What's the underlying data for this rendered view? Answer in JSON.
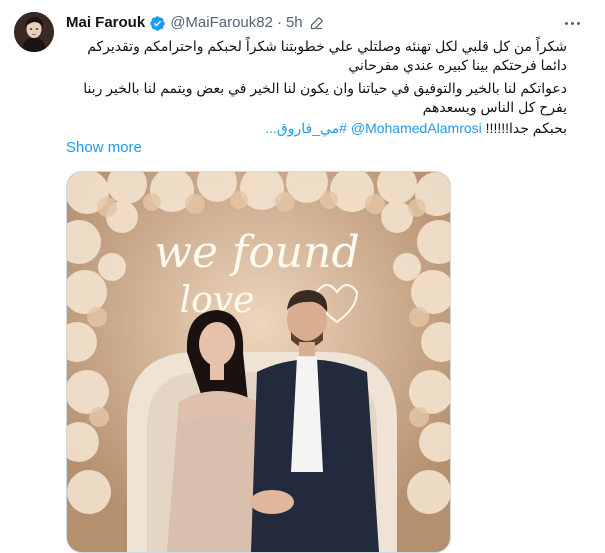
{
  "tweet": {
    "author_name": "Mai Farouk",
    "handle": "@MaiFarouk82",
    "separator": "·",
    "time": "5h",
    "text_line_1": "شكراً من كل قلبي لكل تهنئه وصلتلي علي خطوبتنا شكراً لحبكم واحترامكم وتقديركم دائما فرحتكم بينا كبيره عندي مفرحاني",
    "text_line_2": "دعواتكم لنا بالخير والتوفيق في حياتنا وان يكون لنا الخير في بعض ويتمم لنا بالخير ربنا يفرح كل الناس ويسعدهم",
    "text_thanks": "بحبكم جدا!!!!!!",
    "mention": "@MohamedAlamrosi",
    "hashtag": "#مي_فاروق...",
    "show_more": "Show more",
    "image_text_1": "we found",
    "image_text_2": "love"
  },
  "icons": {
    "verified": "verified-badge-icon",
    "edit": "edited-pencil-icon",
    "more": "more-dots-icon"
  },
  "colors": {
    "link": "#1d9bf0",
    "secondary_text": "#536471",
    "primary_text": "#0f1419"
  }
}
